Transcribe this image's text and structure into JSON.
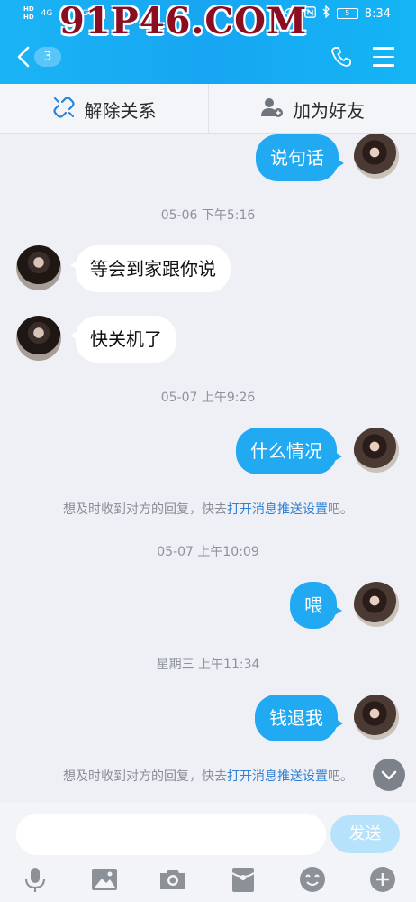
{
  "status_bar": {
    "hd_top": "HD",
    "hd_bottom": "HD",
    "net_4g": "4G",
    "net_4g_b": "4G",
    "battery": "5",
    "time": "8:34"
  },
  "header": {
    "unread_count": "3",
    "watermark": "91P46.COM"
  },
  "actions": {
    "unbind": "解除关系",
    "add_friend": "加为好友"
  },
  "messages": [
    {
      "type": "out",
      "text": "说句话"
    },
    {
      "type": "timestamp",
      "text": "05-06 下午5:16"
    },
    {
      "type": "in",
      "text": "等会到家跟你说"
    },
    {
      "type": "in",
      "text": "快关机了"
    },
    {
      "type": "timestamp",
      "text": "05-07 上午9:26"
    },
    {
      "type": "out",
      "text": "什么情况"
    },
    {
      "type": "system",
      "prefix": "想及时收到对方的回复，快去",
      "link": "打开消息推送设置",
      "suffix": "吧。"
    },
    {
      "type": "timestamp",
      "text": "05-07 上午10:09"
    },
    {
      "type": "out",
      "text": "喂"
    },
    {
      "type": "timestamp",
      "text": "星期三 上午11:34"
    },
    {
      "type": "out",
      "text": "钱退我"
    },
    {
      "type": "system",
      "prefix": "想及时收到对方的回复，快去",
      "link": "打开消息推送设置",
      "suffix": "吧。"
    }
  ],
  "input": {
    "value": "",
    "send_label": "发送"
  },
  "colors": {
    "header": "#17a6f2",
    "bubble_out": "#21aaf1",
    "bubble_in": "#ffffff",
    "link": "#2f7fd3",
    "watermark": "#8a0d21"
  }
}
